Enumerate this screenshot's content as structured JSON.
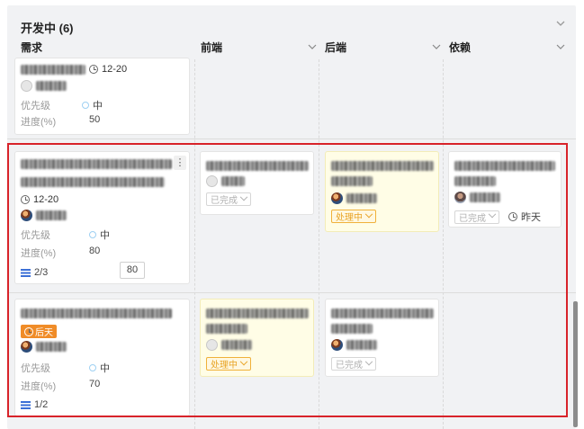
{
  "group": {
    "title": "开发中 (6)"
  },
  "columns": [
    {
      "label": "需求"
    },
    {
      "label": "前端"
    },
    {
      "label": "后端"
    },
    {
      "label": "依赖"
    }
  ],
  "fields": {
    "priority_label": "优先级",
    "progress_label": "进度(%)"
  },
  "cards": {
    "top": {
      "date": "12-20",
      "priority": "中",
      "progress": "50"
    },
    "row1_req": {
      "date": "12-20",
      "priority": "中",
      "progress": "80",
      "subtasks": "2/3",
      "progress_box": "80",
      "more": "⋮"
    },
    "row1_frontend": {
      "status": "已完成"
    },
    "row1_backend": {
      "status": "处理中"
    },
    "row1_dep": {
      "status": "已完成",
      "due": "昨天"
    },
    "row2_req": {
      "due": "后天",
      "priority": "中",
      "progress": "70",
      "subtasks": "1/2"
    },
    "row2_frontend": {
      "status": "处理中"
    },
    "row2_backend": {
      "status": "已完成"
    }
  },
  "colors": {
    "highlight": "#d8232a",
    "doing": "#e8a324",
    "late": "#f08c28",
    "subtask": "#3b6fd6"
  },
  "icons": [
    "chevron-down-icon",
    "clock-icon",
    "avatar",
    "subtask-icon",
    "more-icon"
  ]
}
